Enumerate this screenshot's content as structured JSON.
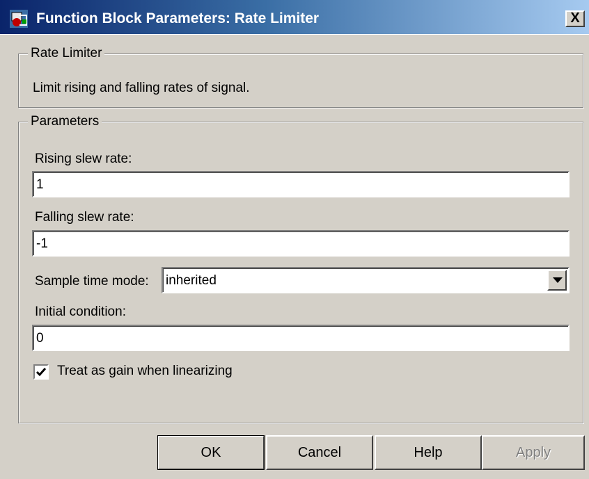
{
  "window": {
    "title": "Function Block Parameters: Rate Limiter",
    "close_label": "X",
    "icon": "simulink-block-icon"
  },
  "description_group": {
    "legend": "Rate Limiter",
    "text": "Limit rising and falling rates of signal."
  },
  "parameters_group": {
    "legend": "Parameters",
    "rising_slew_rate": {
      "label": "Rising slew rate:",
      "value": "1"
    },
    "falling_slew_rate": {
      "label": "Falling slew rate:",
      "value": "-1"
    },
    "sample_time_mode": {
      "label": "Sample time mode:",
      "value": "inherited"
    },
    "initial_condition": {
      "label": "Initial condition:",
      "value": "0"
    },
    "linearize_checkbox": {
      "label": "Treat as gain when linearizing",
      "checked": true
    }
  },
  "buttons": {
    "ok": "OK",
    "cancel": "Cancel",
    "help": "Help",
    "apply": "Apply"
  },
  "colors": {
    "title_gradient_start": "#0a246a",
    "title_gradient_end": "#a6caf0",
    "dialog_face": "#d4d0c8"
  }
}
